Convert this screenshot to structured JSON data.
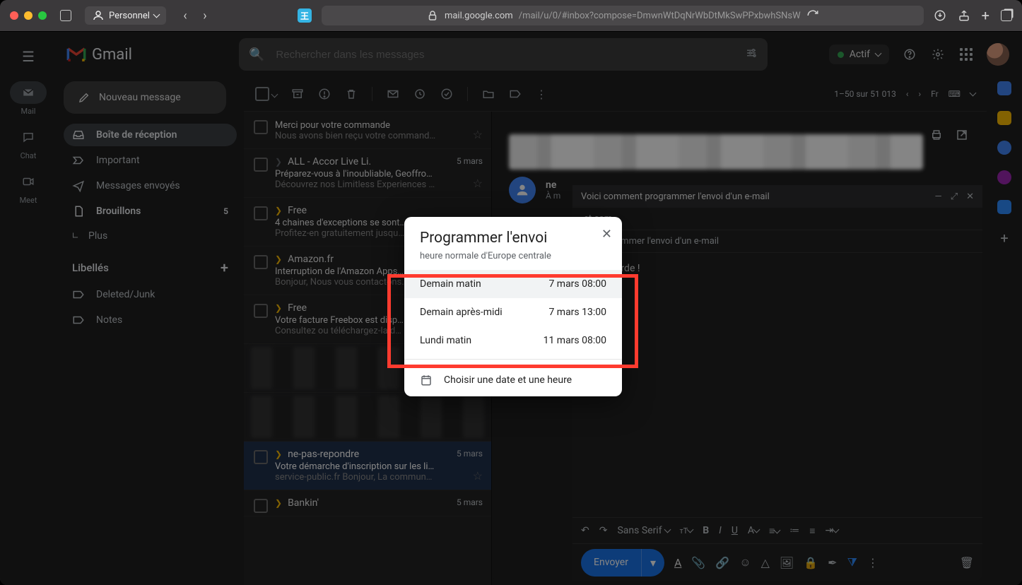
{
  "browser": {
    "profile": "Personnel",
    "url_domain": "mail.google.com",
    "url_path": "/mail/u/0/#inbox?compose=DmwnWtDqNrWbDtMkSwPPxbwhSNsW"
  },
  "rail": {
    "items": [
      {
        "label": "Mail"
      },
      {
        "label": "Chat"
      },
      {
        "label": "Meet"
      }
    ]
  },
  "header": {
    "brand": "Gmail",
    "search_placeholder": "Rechercher dans les messages",
    "status": "Actif"
  },
  "sidebar": {
    "compose": "Nouveau message",
    "items": [
      {
        "label": "Boîte de réception"
      },
      {
        "label": "Important"
      },
      {
        "label": "Messages envoyés"
      },
      {
        "label": "Brouillons",
        "count": "5"
      },
      {
        "label": "Plus"
      }
    ],
    "labels_header": "Libellés",
    "labels": [
      {
        "label": "Deleted/Junk"
      },
      {
        "label": "Notes"
      }
    ]
  },
  "toolbar": {
    "pager": "1–50 sur 51 013",
    "lang": "Fr"
  },
  "messages": [
    {
      "sender": "",
      "subject": "Merci pour votre commande",
      "snippet": "Nous avons bien reçu votre command…",
      "date": "",
      "star": true
    },
    {
      "sender": "ALL - Accor Live Li.",
      "subject": "Préparez-vous à l'inoubliable, Geoffro…",
      "snippet": "Découvrez nos Limitless Experiences …",
      "date": "5 mars",
      "imp": false,
      "star": true
    },
    {
      "sender": "Free",
      "subject": "4 chaines d'exceptions se sont…",
      "snippet": "Profitez-en gratuitement jusqu…",
      "date": "",
      "imp": true
    },
    {
      "sender": "Amazon.fr",
      "subject": "Interruption de l'Amazon Apps…",
      "snippet": "Bonjour, Nous vous contactons…",
      "date": "",
      "imp": true
    },
    {
      "sender": "Free",
      "subject": "Votre facture Freebox est disp…",
      "snippet": "Consultez ou téléchargez-la d…",
      "date": "",
      "imp": true
    },
    {
      "sender": "ne-pas-repondre",
      "subject": "Votre démarche d'inscription sur les li…",
      "snippet": "service-public.fr Bonjour, La commun…",
      "date": "5 mars",
      "imp": true,
      "sel": true,
      "star": true
    },
    {
      "sender": "Bankin'",
      "subject": "",
      "snippet": "",
      "date": "5 mars",
      "imp": true
    }
  ],
  "reader": {
    "from_short": "ne",
    "to": "À m",
    "title": "Voici comment programmer l'envoi d'un e-mail",
    "addr": "et.com",
    "subject2": "nt programmer l'envoi d'un e-mail",
    "body1": "ple, regarde !"
  },
  "composer": {
    "send": "Envoyer",
    "font": "Sans Serif"
  },
  "dialog": {
    "title": "Programmer l'envoi",
    "subtitle": "heure normale d'Europe centrale",
    "options": [
      {
        "label": "Demain matin",
        "time": "7 mars 08:00"
      },
      {
        "label": "Demain après-midi",
        "time": "7 mars 13:00"
      },
      {
        "label": "Lundi matin",
        "time": "11 mars 08:00"
      }
    ],
    "custom": "Choisir une date et une heure"
  }
}
